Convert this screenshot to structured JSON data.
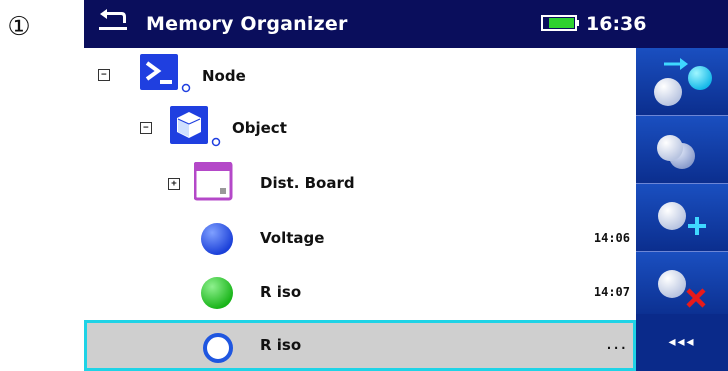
{
  "step_marker": "①",
  "header": {
    "title": "Memory Organizer",
    "time": "16:36"
  },
  "tree": [
    {
      "label": "Node",
      "expander": "−",
      "icon": "node-icon"
    },
    {
      "label": "Object",
      "expander": "−",
      "icon": "object-icon"
    },
    {
      "label": "Dist. Board",
      "expander": "+",
      "icon": "dist-board-icon"
    },
    {
      "label": "Voltage",
      "time": "14:06",
      "icon": "blue-circle-icon",
      "color": "#2a4fe0"
    },
    {
      "label": "R iso",
      "time": "14:07",
      "icon": "green-circle-icon",
      "color": "#22c02a"
    },
    {
      "label": "R iso",
      "time": "...",
      "icon": "empty-circle-icon",
      "color": "#1f56e0"
    }
  ],
  "sidebar": {
    "buttons": [
      "go-to-measurement-icon",
      "clone-icon",
      "add-measurement-icon",
      "delete-measurement-icon"
    ],
    "more_label": "◂◂◂"
  }
}
